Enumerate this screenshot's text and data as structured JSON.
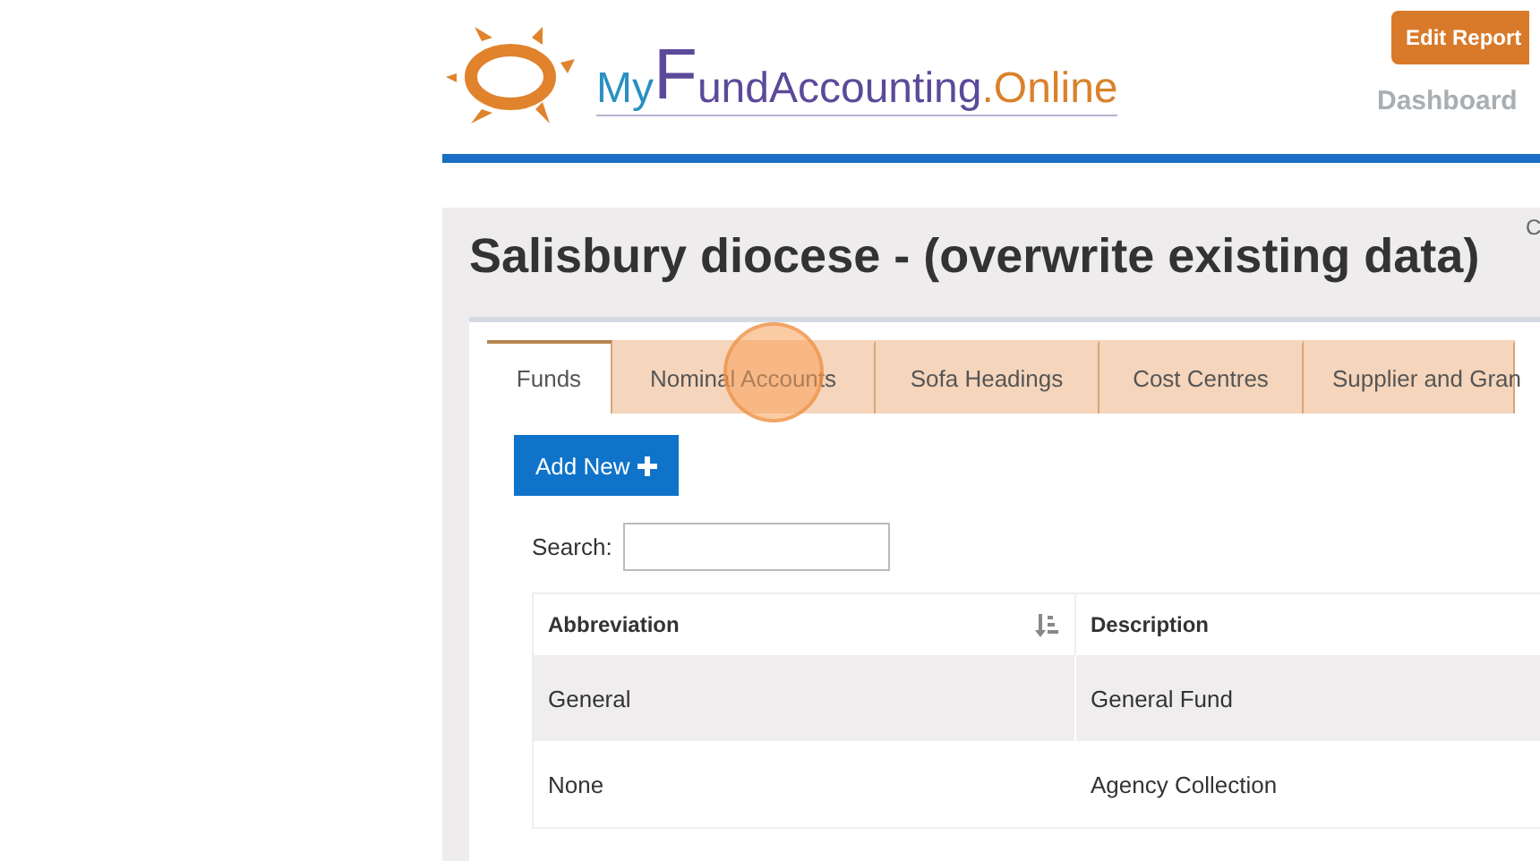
{
  "logo": {
    "my": "My",
    "f": "F",
    "rest": "undAccounting",
    "suffix": ".Online"
  },
  "header": {
    "edit_button": "Edit Report",
    "nav": [
      {
        "label": "Dashboard"
      }
    ]
  },
  "page": {
    "title": "Salisbury diocese - (overwrite existing data)",
    "corner_text": "C"
  },
  "tabs": [
    {
      "label": "Funds",
      "selected": true
    },
    {
      "label": "Nominal Accounts",
      "selected": false
    },
    {
      "label": "Sofa Headings",
      "selected": false
    },
    {
      "label": "Cost Centres",
      "selected": false
    },
    {
      "label": "Supplier and Gran",
      "selected": false
    }
  ],
  "add_button": "Add New",
  "search": {
    "label": "Search:"
  },
  "table": {
    "columns": [
      {
        "label": "Abbreviation",
        "sortable": true
      },
      {
        "label": "Description",
        "sortable": false
      }
    ],
    "rows": [
      {
        "cells": [
          "General",
          "General Fund"
        ],
        "highlighted": true
      },
      {
        "cells": [
          "None",
          "Agency Collection"
        ],
        "highlighted": false
      }
    ]
  }
}
